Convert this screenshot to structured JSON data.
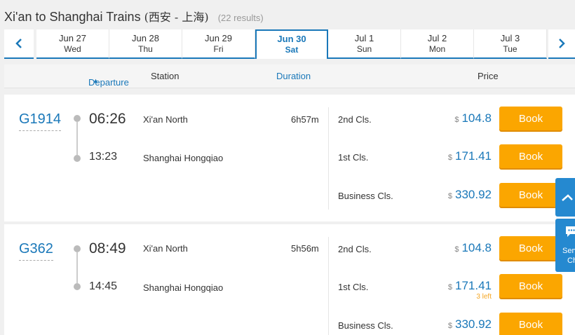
{
  "page": {
    "title": "Xi'an to Shanghai Trains",
    "title_cn": "(西安 - 上海)",
    "result_count": "(22 results)"
  },
  "datebar": {
    "prev_icon": "chevron-left-icon",
    "next_icon": "chevron-right-icon",
    "dates": [
      {
        "date": "Jun 27",
        "weekday": "Wed",
        "active": false
      },
      {
        "date": "Jun 28",
        "weekday": "Thu",
        "active": false
      },
      {
        "date": "Jun 29",
        "weekday": "Fri",
        "active": false
      },
      {
        "date": "Jun 30",
        "weekday": "Sat",
        "active": true
      },
      {
        "date": "Jul 1",
        "weekday": "Sun",
        "active": false
      },
      {
        "date": "Jul 2",
        "weekday": "Mon",
        "active": false
      },
      {
        "date": "Jul 3",
        "weekday": "Tue",
        "active": false
      }
    ]
  },
  "header": {
    "departure": "Departure",
    "station": "Station",
    "duration": "Duration",
    "price": "Price"
  },
  "trains": [
    {
      "number": "G1914",
      "dep_time": "06:26",
      "arr_time": "13:23",
      "dep_station": "Xi'an North",
      "arr_station": "Shanghai Hongqiao",
      "duration": "6h57m",
      "classes": [
        {
          "name": "2nd Cls.",
          "currency": "$",
          "price": "104.8",
          "book": "Book",
          "seats": ""
        },
        {
          "name": "1st Cls.",
          "currency": "$",
          "price": "171.41",
          "book": "Book",
          "seats": ""
        },
        {
          "name": "Business Cls.",
          "currency": "$",
          "price": "330.92",
          "book": "Book",
          "seats": ""
        }
      ]
    },
    {
      "number": "G362",
      "dep_time": "08:49",
      "arr_time": "14:45",
      "dep_station": "Xi'an North",
      "arr_station": "Shanghai Hongqiao",
      "duration": "5h56m",
      "classes": [
        {
          "name": "2nd Cls.",
          "currency": "$",
          "price": "104.8",
          "book": "Book",
          "seats": ""
        },
        {
          "name": "1st Cls.",
          "currency": "$",
          "price": "171.41",
          "book": "Book",
          "seats": "3 left"
        },
        {
          "name": "Business Cls.",
          "currency": "$",
          "price": "330.92",
          "book": "Book",
          "seats": ""
        }
      ]
    }
  ],
  "side": {
    "back_to_top_icon": "chevron-up-icon",
    "chat_icon": "chat-bubble-icon",
    "chat_label_1": "Serv",
    "chat_label_2": "Ch"
  },
  "colors": {
    "accent": "#1a78b9",
    "book_button": "#fba600",
    "side_buttons": "#2589d0",
    "seats_warning": "#f5a623"
  }
}
